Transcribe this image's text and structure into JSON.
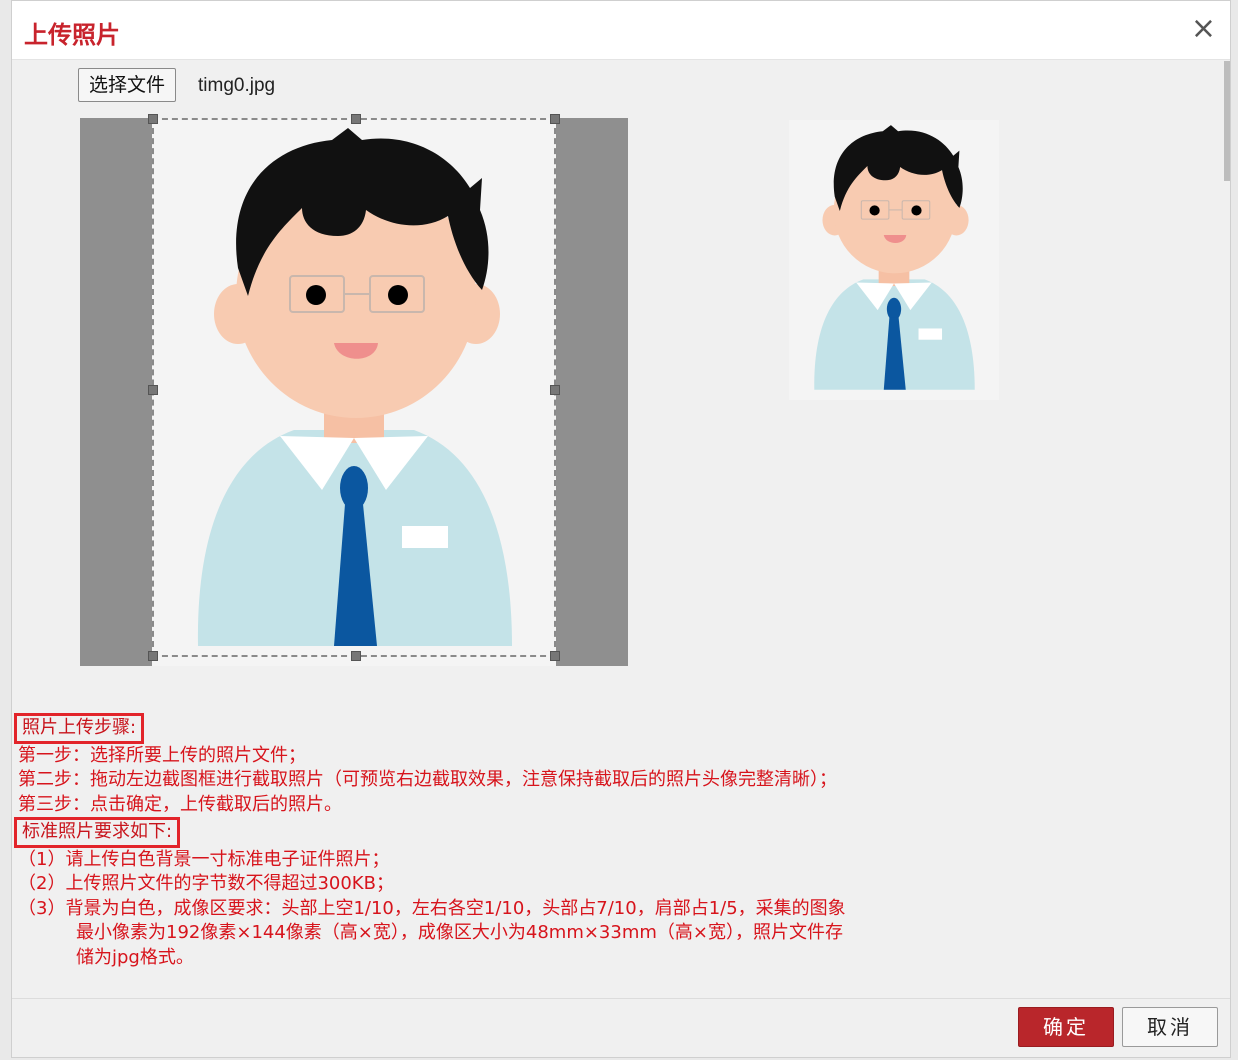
{
  "dialog": {
    "title": "上传照片",
    "close_symbol": "×"
  },
  "file": {
    "button_label": "选择文件",
    "file_name": "timg0.jpg"
  },
  "instructions": {
    "steps_heading": "照片上传步骤:",
    "steps": [
      "第一步：选择所要上传的照片文件；",
      "第二步：拖动左边截图框进行截取照片（可预览右边截取效果，注意保持截取后的照片头像完整清晰）；",
      "第三步：点击确定，上传截取后的照片。"
    ],
    "requirements_heading": "标准照片要求如下:",
    "requirements": [
      "（1）请上传白色背景一寸标准电子证件照片；",
      "（2）上传照片文件的字节数不得超过300KB；",
      "（3）背景为白色，成像区要求：头部上空1/10，左右各空1/10，头部占7/10，肩部占1/5，采集的图象"
    ],
    "requirement_continuation": [
      "最小像素为192像素×144像素（高×宽），成像区大小为48mm×33mm（高×宽），照片文件存",
      "储为jpg格式。"
    ]
  },
  "footer": {
    "confirm_label": "确定",
    "cancel_label": "取消"
  },
  "colors": {
    "accent": "#c8232c",
    "notes": "#d7141c",
    "confirm_bg": "#b9262b",
    "skin": "#f8cbb1",
    "hair": "#111111",
    "shirt": "#c4e3e8",
    "tie": "#0b57a0"
  }
}
